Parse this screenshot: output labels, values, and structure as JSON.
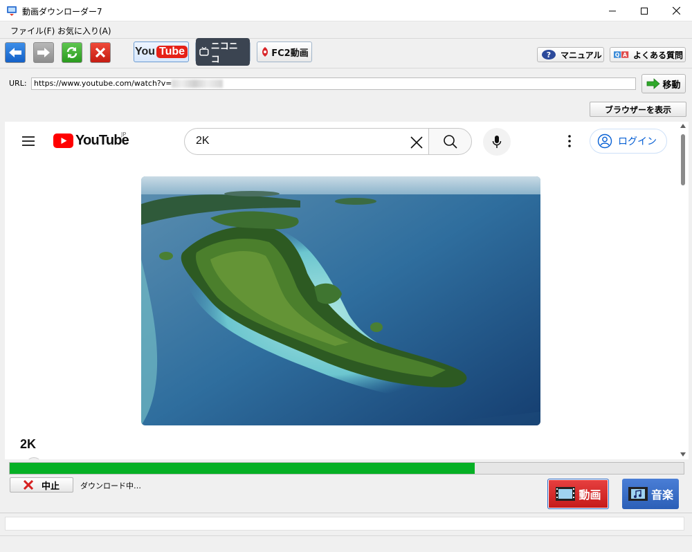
{
  "window": {
    "title": "動画ダウンローダー7"
  },
  "menu": {
    "file": "ファイル(F)",
    "favorites": "お気に入り(A)"
  },
  "toolbar": {
    "sites": {
      "youtube_you": "You",
      "youtube_tube": "Tube",
      "niconico": "ニコニコ",
      "fc2": "FC2動画"
    },
    "manual": "マニュアル",
    "faq": "よくある質問"
  },
  "urlbar": {
    "label": "URL:",
    "value": "https://www.youtube.com/watch?v=",
    "go": "移動"
  },
  "show_browser": "ブラウザーを表示",
  "youtube": {
    "logo_text": "YouTube",
    "region": "JP",
    "search_query": "2K",
    "login": "ログイン",
    "video_title": "2K"
  },
  "download": {
    "progress": 0.69,
    "stop": "中止",
    "status": "ダウンロード中…",
    "video_button": "動画",
    "audio_button": "音楽"
  },
  "colors": {
    "progress_fill": "#06b025",
    "youtube_red": "#ff0000",
    "video_button": "#d42a2a",
    "audio_button": "#3a6fc8"
  }
}
